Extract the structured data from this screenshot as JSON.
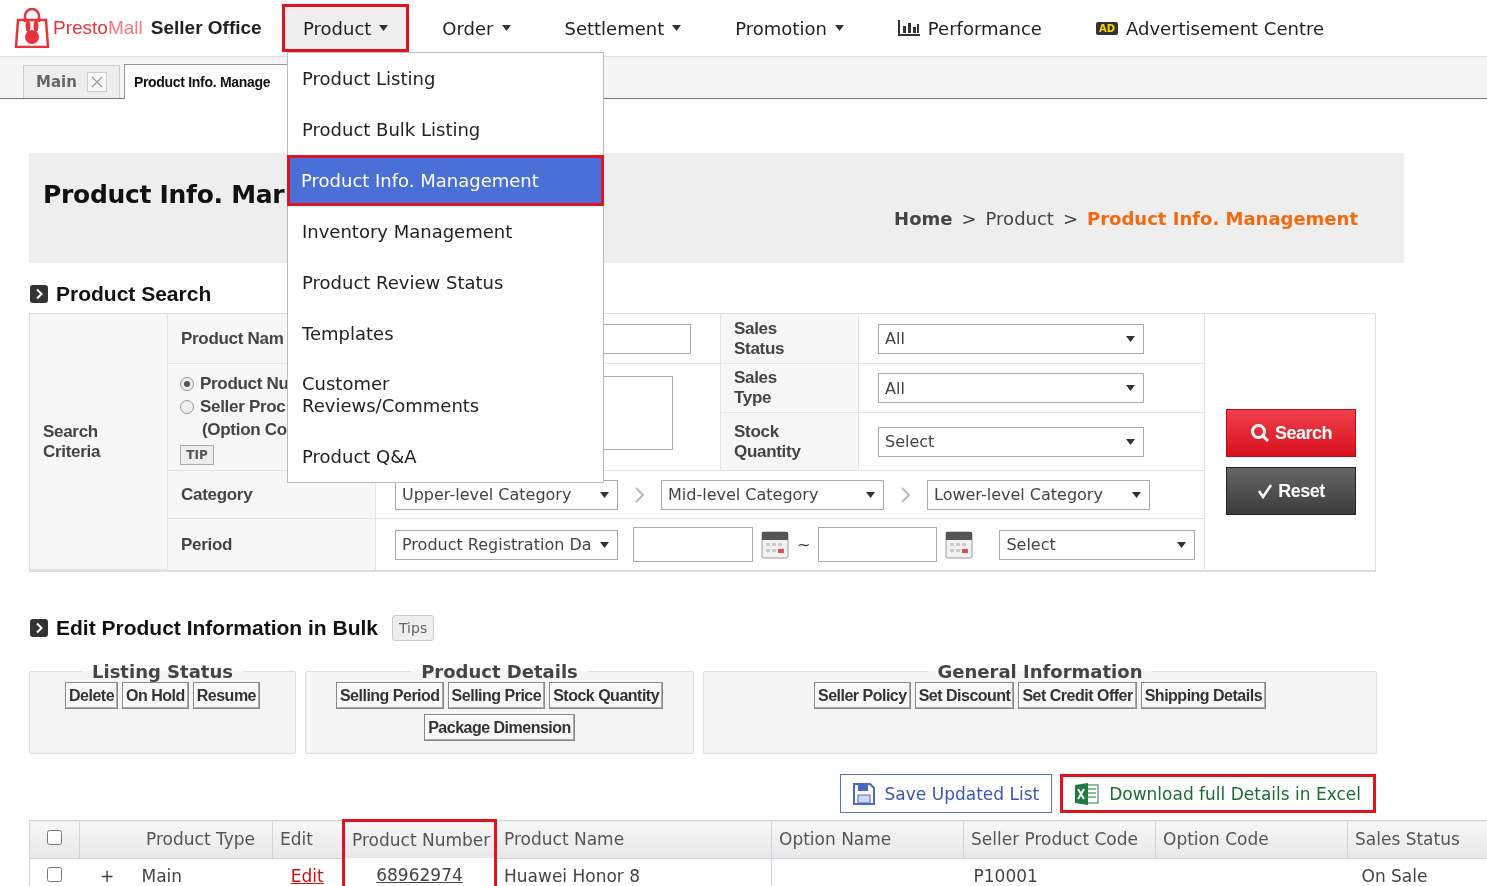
{
  "header": {
    "logo": {
      "brand_first": "Presto",
      "brand_second": "Mall",
      "product": "Seller Office"
    },
    "nav": [
      {
        "label": "Product",
        "kind": "menu",
        "selected": true,
        "annotated": true
      },
      {
        "label": "Order",
        "kind": "menu",
        "selected": false,
        "annotated": false
      },
      {
        "label": "Settlement",
        "kind": "menu",
        "selected": false,
        "annotated": false
      },
      {
        "label": "Promotion",
        "kind": "menu",
        "selected": false,
        "annotated": false
      },
      {
        "label": "Performance",
        "kind": "chart",
        "selected": false,
        "annotated": false
      },
      {
        "label": "Advertisement Centre",
        "kind": "badge",
        "badge": "AD",
        "selected": false,
        "annotated": false
      }
    ]
  },
  "tabs": [
    {
      "label": "Main",
      "closable": true,
      "selected": false
    },
    {
      "label": "Product Info. Manage",
      "selected": true
    }
  ],
  "dropdown": [
    {
      "label": "Product Listing",
      "selected": false,
      "annotated": false
    },
    {
      "label": "Product Bulk Listing",
      "selected": false,
      "annotated": false
    },
    {
      "label": "Product Info. Management",
      "selected": true,
      "annotated": true
    },
    {
      "label": "Inventory Management",
      "selected": false,
      "annotated": false
    },
    {
      "label": "Product Review Status",
      "selected": false,
      "annotated": false
    },
    {
      "label": "Templates",
      "selected": false,
      "annotated": false
    },
    {
      "label": "Customer Reviews/Comments",
      "selected": false,
      "annotated": false
    },
    {
      "label": "Product Q&A",
      "selected": false,
      "annotated": false
    }
  ],
  "page_title": "Product Info. Mar",
  "breadcrumb": [
    {
      "label": "Home",
      "current": false
    },
    {
      "label": "Product",
      "current": false
    },
    {
      "label": "Product Info. Management",
      "current": true
    }
  ],
  "breadcrumb_separator": ">",
  "search": {
    "title": "Product Search",
    "criteria_label": "Search Criteria",
    "product_name_label": "Product Nam",
    "number_options": [
      {
        "label": "Product Nu",
        "selected": true
      },
      {
        "label": "Seller Proc",
        "selected": false
      }
    ],
    "option_note": "(Option Co",
    "tip": "TIP",
    "sales_status": {
      "label": "Sales Status",
      "value": "All"
    },
    "sales_type": {
      "label": "Sales Type",
      "value": "All"
    },
    "stock_quantity": {
      "label": "Stock Quantity",
      "value": "Select"
    },
    "category": {
      "label": "Category",
      "selects": [
        "Upper-level Category",
        "Mid-level Category",
        "Lower-level Category"
      ]
    },
    "period": {
      "label": "Period",
      "type": "Product Registration Da",
      "separator": "~",
      "range": "Select"
    },
    "search_button": "Search",
    "reset_button": "Reset"
  },
  "bulk": {
    "title": "Edit Product Information in Bulk",
    "tips": "Tips",
    "groups": [
      {
        "legend": "Listing Status",
        "buttons": [
          "Delete",
          "On Hold",
          "Resume"
        ]
      },
      {
        "legend": "Product Details",
        "buttons": [
          "Selling Period",
          "Selling Price",
          "Stock Quantity",
          "Package Dimension"
        ]
      },
      {
        "legend": "General Information",
        "buttons": [
          "Seller Policy",
          "Set Discount",
          "Set Credit Offer",
          "Shipping Details"
        ]
      }
    ]
  },
  "actions": [
    {
      "label": "Save Updated List",
      "kind": "save",
      "annotated": false
    },
    {
      "label": "Download full Details in Excel",
      "kind": "excel",
      "annotated": true
    }
  ],
  "table": {
    "select_all": {
      "checked": false
    },
    "columns": [
      {
        "label": "Product Type",
        "annotated": false
      },
      {
        "label": "Edit",
        "annotated": false
      },
      {
        "label": "Product Number",
        "annotated": true
      },
      {
        "label": "Product Name",
        "annotated": false
      },
      {
        "label": "Option Name",
        "annotated": false
      },
      {
        "label": "Seller Product Code",
        "annotated": false
      },
      {
        "label": "Option Code",
        "annotated": false
      },
      {
        "label": "Sales Status",
        "annotated": false
      }
    ],
    "rows": [
      {
        "checked": false,
        "expand": "+",
        "product_type": "Main",
        "edit": "Edit",
        "product_number": "68962974",
        "product_name": "Huawei Honor 8",
        "seller_product_code": "P10001",
        "sales_status": "On Sale"
      }
    ]
  }
}
